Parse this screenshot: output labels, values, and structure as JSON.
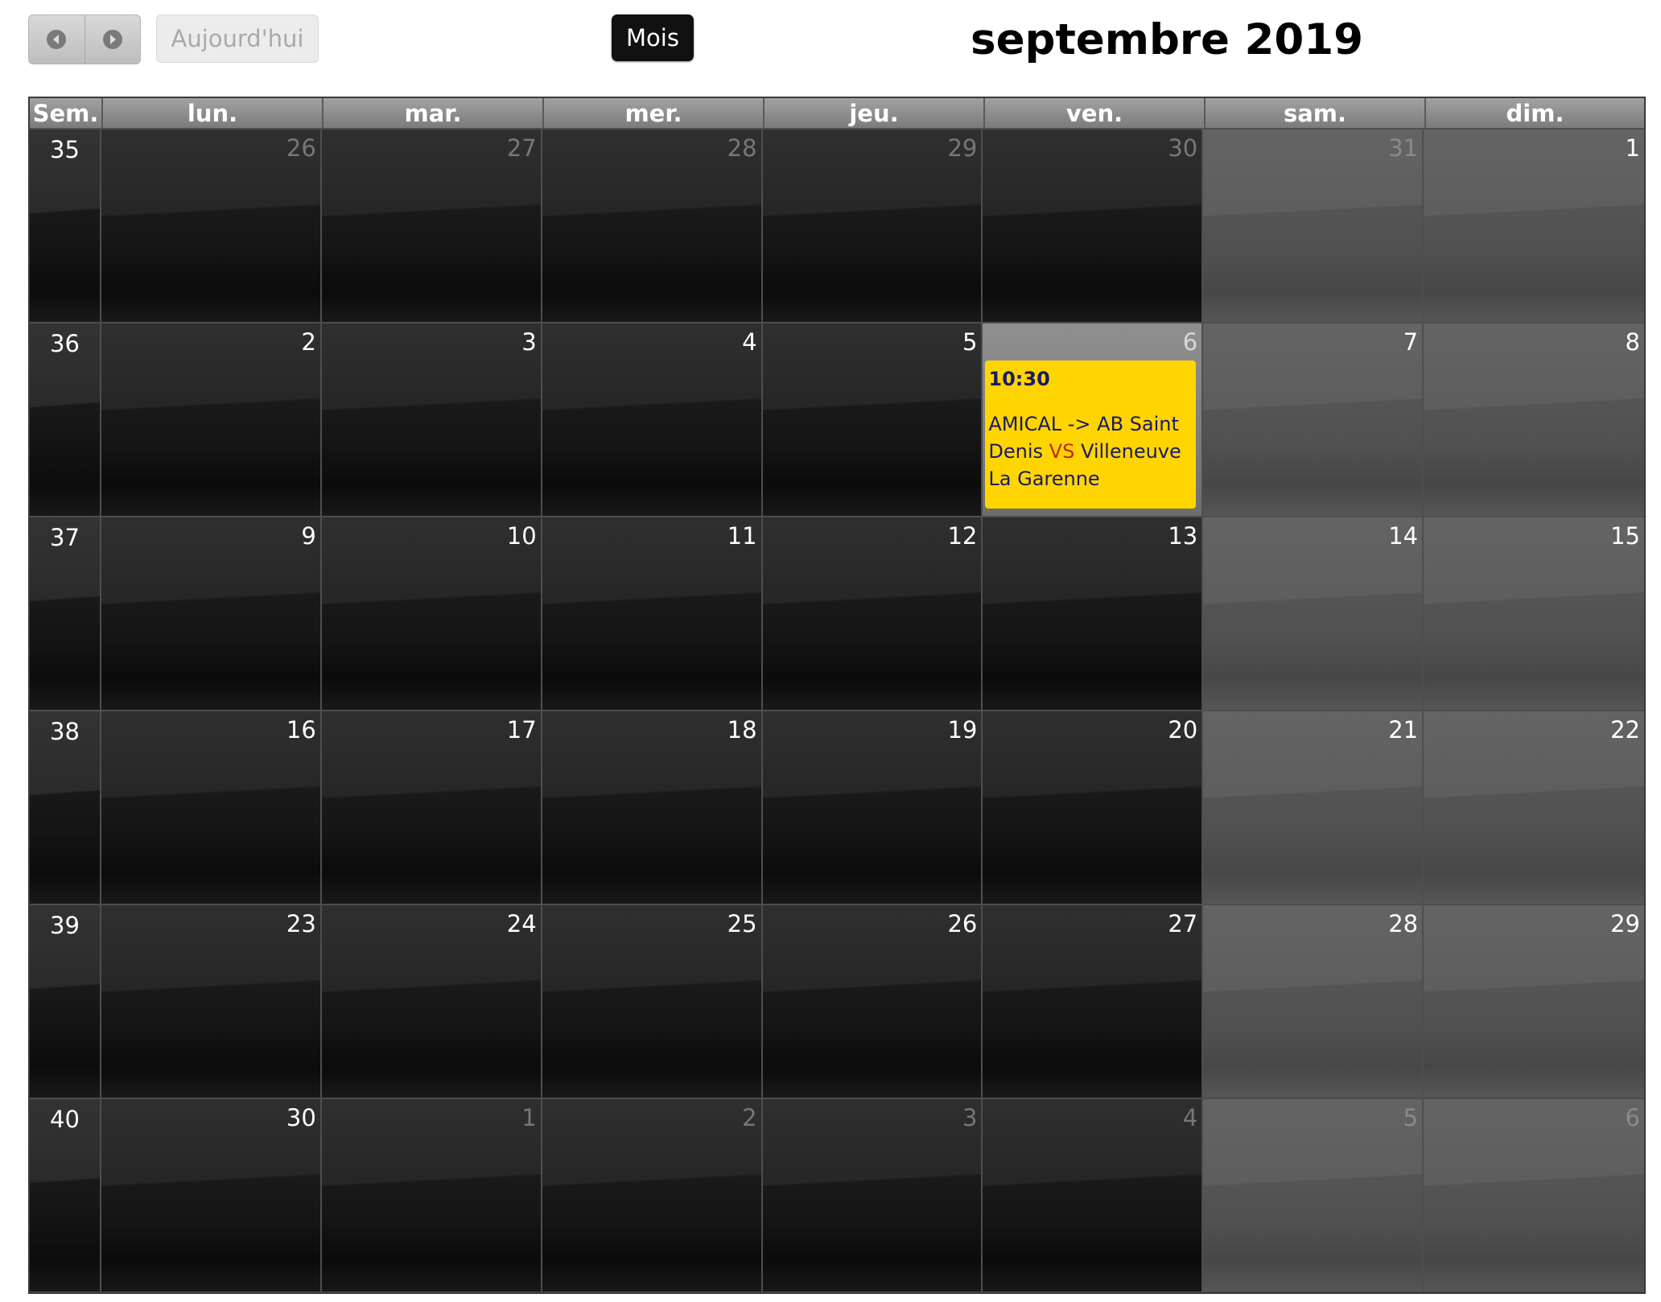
{
  "toolbar": {
    "prev_icon": "chevron-left-icon",
    "next_icon": "chevron-right-icon",
    "today_label": "Aujourd'hui",
    "view_label": "Mois",
    "title": "septembre 2019"
  },
  "calendar": {
    "headers": [
      "Sem.",
      "lun.",
      "mar.",
      "mer.",
      "jeu.",
      "ven.",
      "sam.",
      "dim."
    ],
    "weeks": [
      {
        "num": "35",
        "days": [
          "26",
          "27",
          "28",
          "29",
          "30",
          "31",
          "1"
        ]
      },
      {
        "num": "36",
        "days": [
          "2",
          "3",
          "4",
          "5",
          "6",
          "7",
          "8"
        ]
      },
      {
        "num": "37",
        "days": [
          "9",
          "10",
          "11",
          "12",
          "13",
          "14",
          "15"
        ]
      },
      {
        "num": "38",
        "days": [
          "16",
          "17",
          "18",
          "19",
          "20",
          "21",
          "22"
        ]
      },
      {
        "num": "39",
        "days": [
          "23",
          "24",
          "25",
          "26",
          "27",
          "28",
          "29"
        ]
      },
      {
        "num": "40",
        "days": [
          "30",
          "1",
          "2",
          "3",
          "4",
          "5",
          "6"
        ]
      }
    ],
    "event": {
      "time": "10:30",
      "text_before": "AMICAL -> AB Saint Denis ",
      "vs": "VS",
      "text_after": " Villeneuve La Garenne"
    }
  },
  "colors": {
    "event_bg": "#ffd500",
    "event_text": "#1a1a66",
    "vs_text": "#c0290a",
    "header_bg": "#8a8a8a",
    "weekday_bg": "#1a1a1a",
    "weekend_bg": "#555555",
    "today_bg": "#8a8a8a"
  }
}
